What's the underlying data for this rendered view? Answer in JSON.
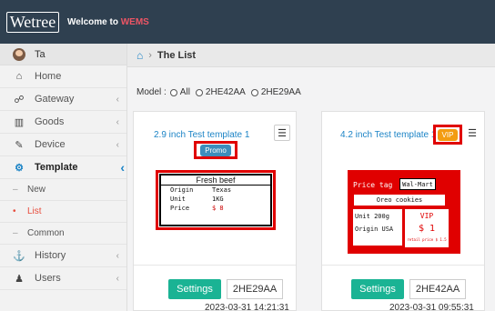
{
  "header": {
    "logo": "Wetree",
    "welcome_prefix": "Welcome to ",
    "brand": "WEMS"
  },
  "sidebar": {
    "user": "Ta",
    "items": [
      {
        "label": "Home",
        "icon": "home-icon"
      },
      {
        "label": "Gateway",
        "icon": "sitemap-icon"
      },
      {
        "label": "Goods",
        "icon": "barcode-icon"
      },
      {
        "label": "Device",
        "icon": "device-icon"
      },
      {
        "label": "Template",
        "icon": "gears-icon"
      },
      {
        "label": "History",
        "icon": "anchor-icon"
      },
      {
        "label": "Users",
        "icon": "user-icon"
      }
    ],
    "sub_items": [
      {
        "label": "New"
      },
      {
        "label": "List"
      },
      {
        "label": "Common"
      }
    ],
    "chevron": "‹"
  },
  "breadcrumb": {
    "sep": "›",
    "current": "The List"
  },
  "filter": {
    "label": "Model :",
    "options": [
      "All",
      "2HE42AA",
      "2HE29AA"
    ]
  },
  "cards": [
    {
      "name": "2.9 inch Test template 1",
      "badge": "Promo",
      "mac": "2HE29AA",
      "settings": "Settings",
      "timestamp": "2023-03-31 14:21:31",
      "label": {
        "title": "Fresh beef",
        "rows": [
          {
            "k": "Origin",
            "v": "Texas"
          },
          {
            "k": "Unit",
            "v": "1KG"
          },
          {
            "k": "Price",
            "v": "$ 8"
          }
        ]
      }
    },
    {
      "name": "4.2 inch Test template 1",
      "badge": "VIP",
      "mac": "2HE42AA",
      "settings": "Settings",
      "timestamp": "2023-03-31 09:55:31",
      "label": {
        "price_tag": "Price tag",
        "store": "Wal-Mart",
        "product": "Oreo cookies",
        "unit": "Unit 200g",
        "origin": "Origin USA",
        "vip": "VIP",
        "vip_price": "$ 1",
        "retail": "retail price $ 1.5"
      }
    }
  ],
  "colors": {
    "topbar": "#2f4050",
    "accent": "#1c84c6",
    "settings": "#1ab394",
    "highlight": "#e00000"
  }
}
